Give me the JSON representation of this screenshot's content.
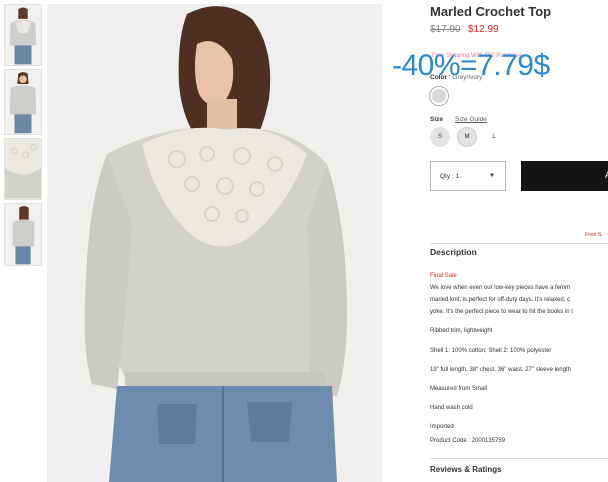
{
  "product": {
    "title": "Marled Crochet Top",
    "original_price": "$17.90",
    "sale_price": "$12.99",
    "promo_text": "Free Shipping With $50 Purchase",
    "discount_overlay": "-40%=7.79$"
  },
  "color": {
    "label": "Color",
    "value": "Grey/Ivory",
    "swatch_color": "#d9d8d4"
  },
  "size": {
    "label": "Size",
    "guide_label": "Size Guide",
    "options": [
      "S",
      "M",
      "L"
    ],
    "selected": "M"
  },
  "quantity": {
    "label": "Qty : 1",
    "caret": "▼"
  },
  "add_to_bag": {
    "label": "A",
    "color": "#141414"
  },
  "shipping_note": "Free S",
  "description": {
    "heading": "Description",
    "final_sale": "Final Sale",
    "lines": [
      "We love when even our low-key pieces have a femm",
      "marled knit, is perfect for off-duty days. It's relaxed, c",
      "yoke. It's the perfect piece to wear to hit the books in t"
    ],
    "details": [
      "Ribbed trim, lightweight",
      "Shell 1: 100% cotton; Shell 2: 100% polyester",
      "19\" full length, 38\" chest, 36\" waist, 27\" sleeve length",
      "Measured from Small",
      "Hand wash cold",
      "Imported",
      "Product Code : 2000135759"
    ]
  },
  "reviews_heading": "Reviews & Ratings",
  "colors": {
    "sale_red": "#e2231a",
    "overlay_blue": "#2b8ad6",
    "promo_pink": "#e97a97"
  }
}
